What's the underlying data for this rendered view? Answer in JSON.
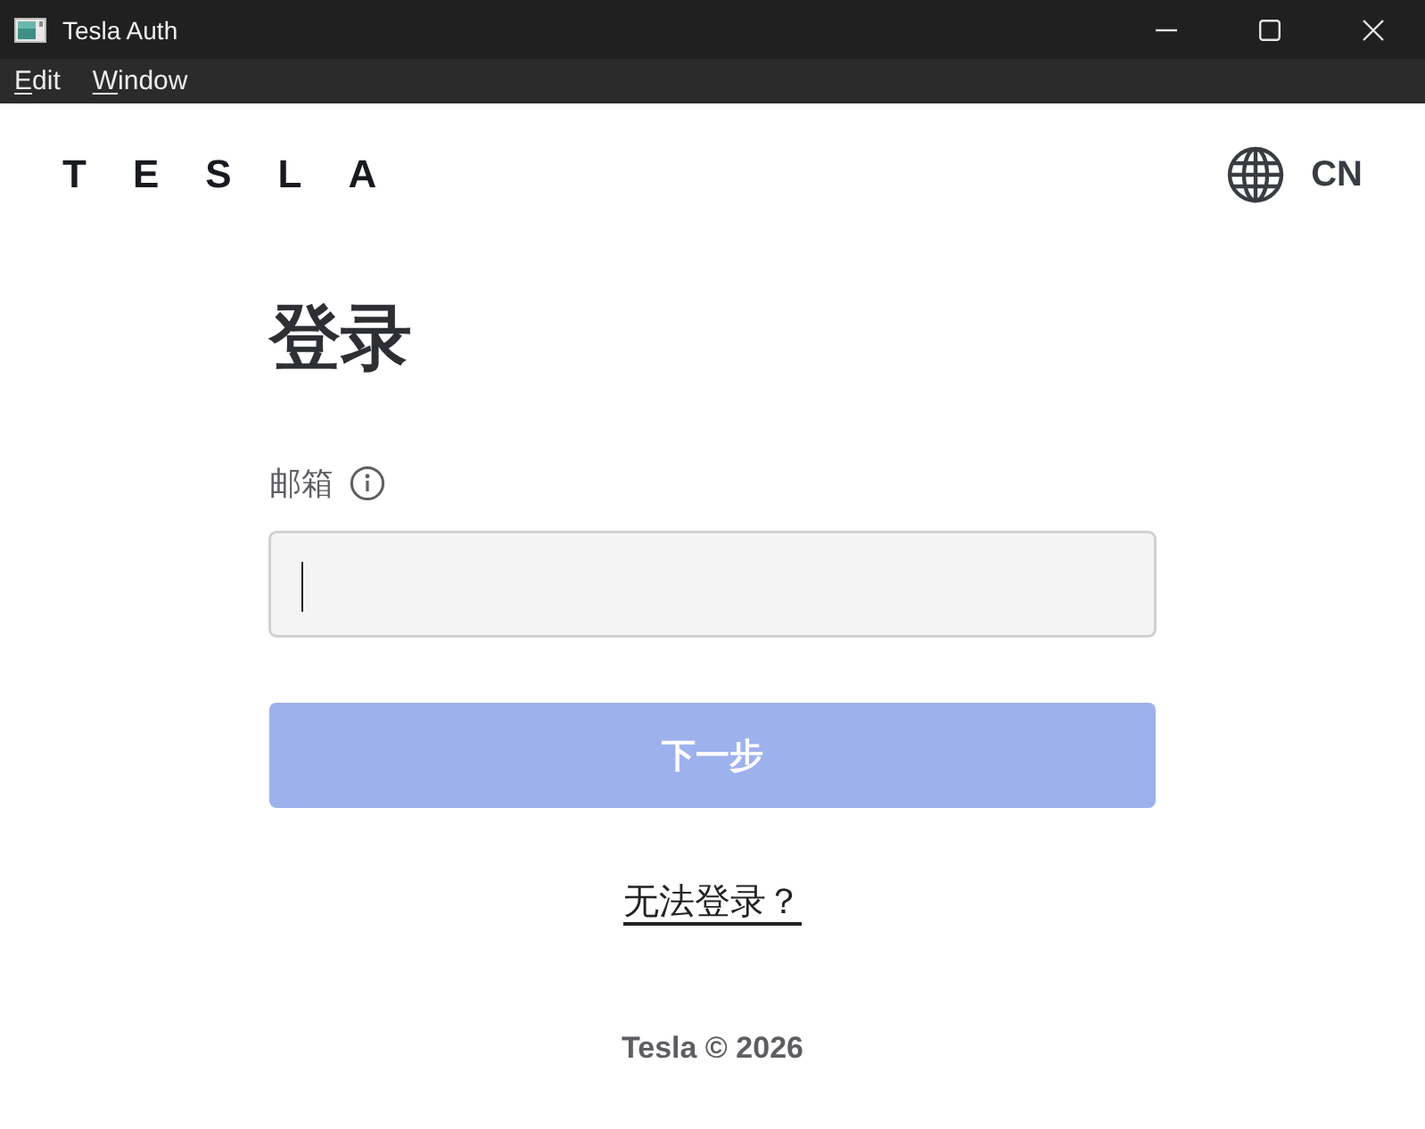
{
  "window": {
    "title": "Tesla Auth"
  },
  "menu_bar": [
    {
      "key": "E",
      "rest": "dit"
    },
    {
      "key": "W",
      "rest": "indow"
    }
  ],
  "header": {
    "logo": "TESLA",
    "language": "CN"
  },
  "form": {
    "heading": "登录",
    "email": {
      "label": "邮箱",
      "focused": true
    },
    "next_button": {
      "label": "下一步",
      "disabled": true
    },
    "help_link": "无法登录？"
  },
  "footer": "Tesla © 2026"
}
